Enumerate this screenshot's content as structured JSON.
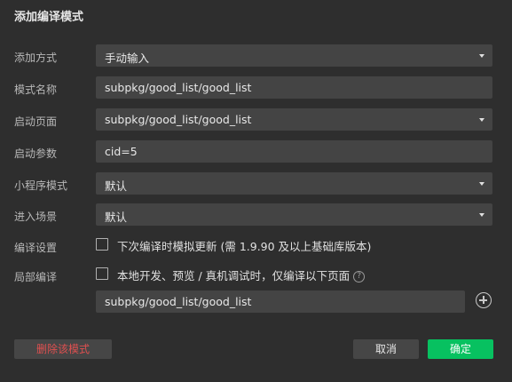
{
  "dialog": {
    "title": "添加编译模式"
  },
  "form": {
    "add_method": {
      "label": "添加方式",
      "value": "手动输入"
    },
    "mode_name": {
      "label": "模式名称",
      "value": "subpkg/good_list/good_list"
    },
    "launch_page": {
      "label": "启动页面",
      "value": "subpkg/good_list/good_list"
    },
    "launch_params": {
      "label": "启动参数",
      "value": "cid=5"
    },
    "miniprogram_mode": {
      "label": "小程序模式",
      "value": "默认"
    },
    "enter_scene": {
      "label": "进入场景",
      "value": "默认"
    },
    "compile_settings": {
      "label": "编译设置",
      "checkbox_text": "下次编译时模拟更新 (需 1.9.90 及以上基础库版本)",
      "checked": false
    },
    "partial_compile": {
      "label": "局部编译",
      "checkbox_text": "本地开发、预览 / 真机调试时，仅编译以下页面",
      "checked": false,
      "help_icon": "?",
      "page_value": "subpkg/good_list/good_list"
    }
  },
  "buttons": {
    "delete": "删除该模式",
    "cancel": "取消",
    "ok": "确定"
  },
  "colors": {
    "background": "#2e2e2e",
    "field": "#444444",
    "primary": "#07c160",
    "danger": "#e05050"
  }
}
